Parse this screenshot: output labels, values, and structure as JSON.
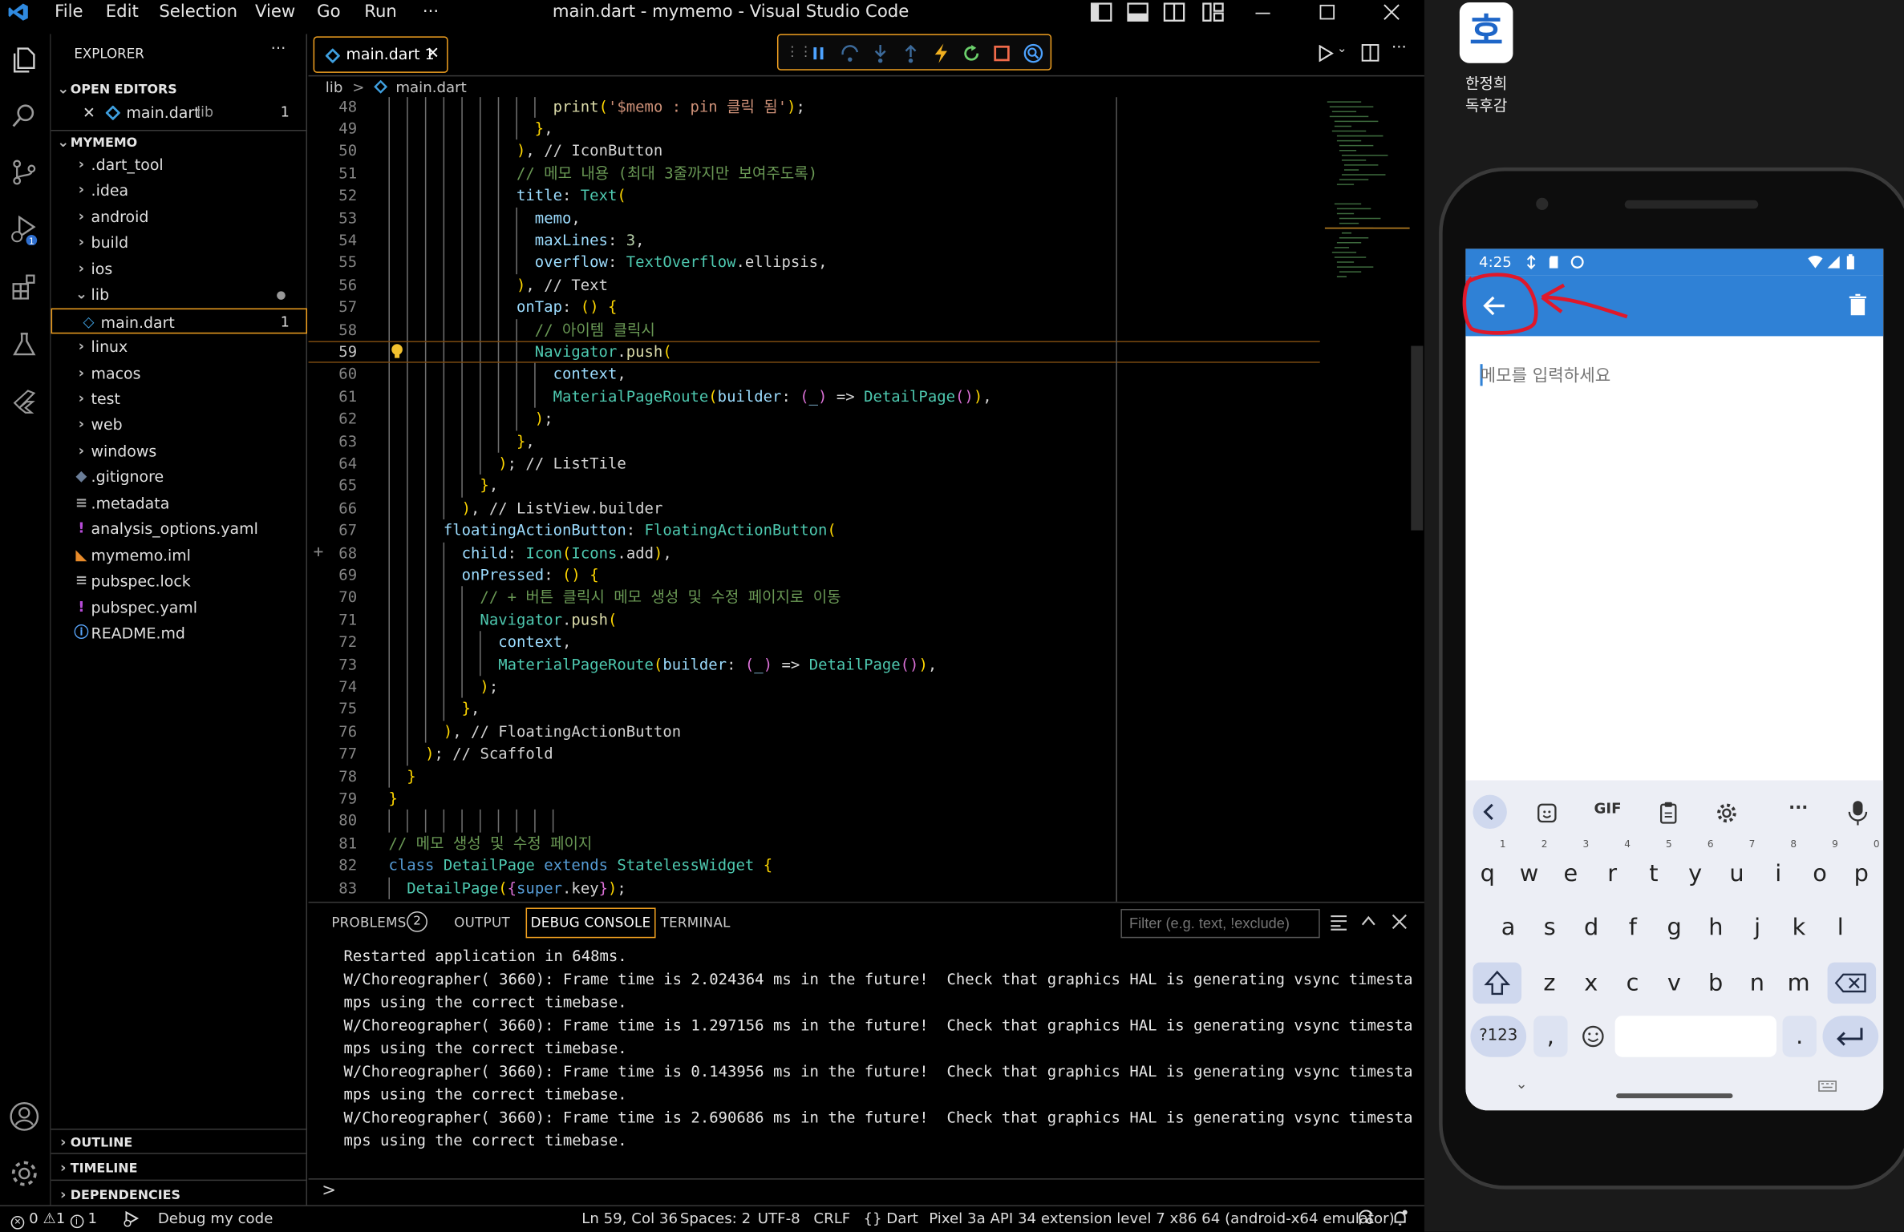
{
  "titlebar": {
    "menu": [
      "File",
      "Edit",
      "Selection",
      "View",
      "Go",
      "Run",
      "···"
    ],
    "title": "main.dart - mymemo - Visual Studio Code"
  },
  "tabs": {
    "active": "main.dart 1",
    "close": "✕"
  },
  "breadcrumb": [
    "lib",
    ">",
    "main.dart"
  ],
  "explorer": {
    "header": "EXPLORER",
    "dots": "···",
    "open_editors": "OPEN EDITORS",
    "open_file": "main.dart",
    "open_file_dir": "lib",
    "open_file_badge": "1",
    "project": "MYMEMO",
    "items": [
      {
        "label": ".dart_tool",
        "type": "folder"
      },
      {
        "label": ".idea",
        "type": "folder"
      },
      {
        "label": "android",
        "type": "folder"
      },
      {
        "label": "build",
        "type": "folder"
      },
      {
        "label": "ios",
        "type": "folder"
      },
      {
        "label": "lib",
        "type": "folder-open"
      },
      {
        "label": "main.dart",
        "type": "file-dart"
      },
      {
        "label": "linux",
        "type": "folder"
      },
      {
        "label": "macos",
        "type": "folder"
      },
      {
        "label": "test",
        "type": "folder"
      },
      {
        "label": "web",
        "type": "folder"
      },
      {
        "label": "windows",
        "type": "folder"
      },
      {
        "label": ".gitignore",
        "type": "file-git"
      },
      {
        "label": ".metadata",
        "type": "file-lines"
      },
      {
        "label": "analysis_options.yaml",
        "type": "file-yaml"
      },
      {
        "label": "mymemo.iml",
        "type": "file-rss"
      },
      {
        "label": "pubspec.lock",
        "type": "file-lines"
      },
      {
        "label": "pubspec.yaml",
        "type": "file-yaml"
      },
      {
        "label": "README.md",
        "type": "file-info"
      }
    ],
    "main_badge": "1",
    "outline": "OUTLINE",
    "timeline": "TIMELINE",
    "dependencies": "DEPENDENCIES"
  },
  "code_lines": [
    {
      "n": "48",
      "t": "                  print('$memo : pin 클릭 됨');"
    },
    {
      "n": "49",
      "t": "                },"
    },
    {
      "n": "50",
      "t": "              ), // IconButton"
    },
    {
      "n": "51",
      "t": "              // 메모 내용 (최대 3줄까지만 보여주도록)"
    },
    {
      "n": "52",
      "t": "              title: Text("
    },
    {
      "n": "53",
      "t": "                memo,"
    },
    {
      "n": "54",
      "t": "                maxLines: 3,"
    },
    {
      "n": "55",
      "t": "                overflow: TextOverflow.ellipsis,"
    },
    {
      "n": "56",
      "t": "              ), // Text"
    },
    {
      "n": "57",
      "t": "              onTap: () {"
    },
    {
      "n": "58",
      "t": "                // 아이템 클릭시"
    },
    {
      "n": "59",
      "t": "                Navigator.push("
    },
    {
      "n": "60",
      "t": "                  context,"
    },
    {
      "n": "61",
      "t": "                  MaterialPageRoute(builder: (_) => DetailPage()),"
    },
    {
      "n": "62",
      "t": "                );"
    },
    {
      "n": "63",
      "t": "              },"
    },
    {
      "n": "64",
      "t": "            ); // ListTile"
    },
    {
      "n": "65",
      "t": "          },"
    },
    {
      "n": "66",
      "t": "        ), // ListView.builder"
    },
    {
      "n": "67",
      "t": "      floatingActionButton: FloatingActionButton("
    },
    {
      "n": "68",
      "t": "        child: Icon(Icons.add),"
    },
    {
      "n": "69",
      "t": "        onPressed: () {"
    },
    {
      "n": "70",
      "t": "          // + 버튼 클릭시 메모 생성 및 수정 페이지로 이동"
    },
    {
      "n": "71",
      "t": "          Navigator.push("
    },
    {
      "n": "72",
      "t": "            context,"
    },
    {
      "n": "73",
      "t": "            MaterialPageRoute(builder: (_) => DetailPage()),"
    },
    {
      "n": "74",
      "t": "          );"
    },
    {
      "n": "75",
      "t": "        },"
    },
    {
      "n": "76",
      "t": "      ), // FloatingActionButton"
    },
    {
      "n": "77",
      "t": "    ); // Scaffold"
    },
    {
      "n": "78",
      "t": "  }"
    },
    {
      "n": "79",
      "t": "}"
    },
    {
      "n": "80",
      "t": ""
    },
    {
      "n": "81",
      "t": "// 메모 생성 및 수정 페이지"
    },
    {
      "n": "82",
      "t": "class DetailPage extends StatelessWidget {"
    },
    {
      "n": "83",
      "t": "  DetailPage({super.key});"
    }
  ],
  "panel": {
    "tabs": [
      "PROBLEMS",
      "OUTPUT",
      "DEBUG CONSOLE",
      "TERMINAL"
    ],
    "problems_count": "2",
    "filter_placeholder": "Filter (e.g. text, !exclude)",
    "prompt": ">",
    "console": [
      "Restarted application in 648ms.",
      "W/Choreographer( 3660): Frame time is 2.024364 ms in the future!  Check that graphics HAL is generating vsync timesta",
      "mps using the correct timebase.",
      "W/Choreographer( 3660): Frame time is 1.297156 ms in the future!  Check that graphics HAL is generating vsync timesta",
      "mps using the correct timebase.",
      "W/Choreographer( 3660): Frame time is 0.143956 ms in the future!  Check that graphics HAL is generating vsync timesta",
      "mps using the correct timebase.",
      "W/Choreographer( 3660): Frame time is 2.690686 ms in the future!  Check that graphics HAL is generating vsync timesta",
      "mps using the correct timebase."
    ]
  },
  "statusbar": {
    "errors": "0",
    "warnings": "1",
    "infos": "1",
    "debug": "Debug my code",
    "position": "Ln 59, Col 36",
    "spaces": "Spaces: 2",
    "encoding": "UTF-8",
    "eol": "CRLF",
    "language_brace": "{}",
    "language": "Dart",
    "device": "Pixel 3a API 34 extension level 7 x86 64 (android-x64 emulator)"
  },
  "desktop": {
    "icon_glyph": "호",
    "icon_label_1": "한정희",
    "icon_label_2": "독후감"
  },
  "phone": {
    "time": "4:25",
    "placeholder": "메모를 입력하세요",
    "keyboard": {
      "row1": [
        {
          "k": "q",
          "n": "1"
        },
        {
          "k": "w",
          "n": "2"
        },
        {
          "k": "e",
          "n": "3"
        },
        {
          "k": "r",
          "n": "4"
        },
        {
          "k": "t",
          "n": "5"
        },
        {
          "k": "y",
          "n": "6"
        },
        {
          "k": "u",
          "n": "7"
        },
        {
          "k": "i",
          "n": "8"
        },
        {
          "k": "o",
          "n": "9"
        },
        {
          "k": "p",
          "n": "0"
        }
      ],
      "row2": [
        "a",
        "s",
        "d",
        "f",
        "g",
        "h",
        "j",
        "k",
        "l"
      ],
      "row3": [
        "z",
        "x",
        "c",
        "v",
        "b",
        "n",
        "m"
      ],
      "sym": "?123",
      "comma": ",",
      "period": ".",
      "gif": "GIF",
      "more": "···"
    }
  },
  "colors": {
    "accent_orange": "#f0a020",
    "app_blue": "#2f81d6",
    "annotation_red": "#e0182a"
  }
}
